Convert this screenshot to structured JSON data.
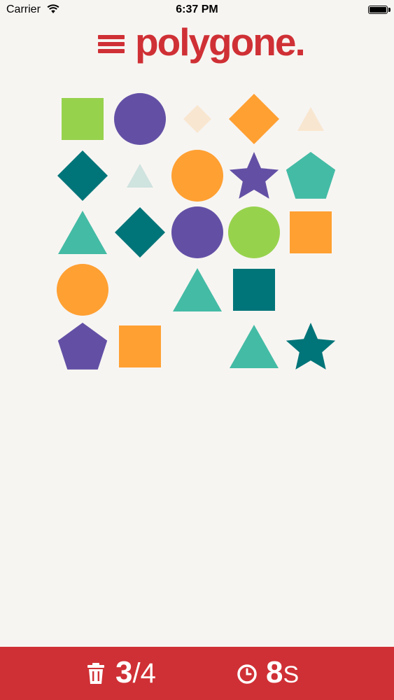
{
  "status_bar": {
    "carrier": "Carrier",
    "time": "6:37 PM"
  },
  "header": {
    "logo": "polygone.",
    "menu_icon": "hamburger-menu-icon"
  },
  "colors": {
    "red": "#cf3035",
    "green": "#97d24d",
    "purple": "#6350a5",
    "orange": "#ffa032",
    "teal": "#007579",
    "turquoise": "#44bba5",
    "pale_peach": "#f8e6d0",
    "pale_mint": "#cfe3df"
  },
  "board": {
    "columns": 5,
    "rows": 5,
    "tiles": [
      {
        "row": 0,
        "col": 0,
        "shape": "square",
        "color": "green"
      },
      {
        "row": 0,
        "col": 1,
        "shape": "circle",
        "color": "purple"
      },
      {
        "row": 0,
        "col": 2,
        "shape": "diamond",
        "color": "pale_peach",
        "size": "small"
      },
      {
        "row": 0,
        "col": 3,
        "shape": "diamond",
        "color": "orange"
      },
      {
        "row": 0,
        "col": 4,
        "shape": "triangle",
        "color": "pale_peach",
        "size": "small"
      },
      {
        "row": 1,
        "col": 0,
        "shape": "diamond",
        "color": "teal"
      },
      {
        "row": 1,
        "col": 1,
        "shape": "triangle",
        "color": "pale_mint",
        "size": "small"
      },
      {
        "row": 1,
        "col": 2,
        "shape": "circle",
        "color": "orange"
      },
      {
        "row": 1,
        "col": 3,
        "shape": "star",
        "color": "purple"
      },
      {
        "row": 1,
        "col": 4,
        "shape": "pentagon",
        "color": "turquoise"
      },
      {
        "row": 2,
        "col": 0,
        "shape": "triangle",
        "color": "turquoise"
      },
      {
        "row": 2,
        "col": 1,
        "shape": "diamond",
        "color": "teal"
      },
      {
        "row": 2,
        "col": 2,
        "shape": "circle",
        "color": "purple"
      },
      {
        "row": 2,
        "col": 3,
        "shape": "circle",
        "color": "green"
      },
      {
        "row": 2,
        "col": 4,
        "shape": "square",
        "color": "orange"
      },
      {
        "row": 3,
        "col": 0,
        "shape": "circle",
        "color": "orange"
      },
      {
        "row": 3,
        "col": 2,
        "shape": "triangle",
        "color": "turquoise"
      },
      {
        "row": 3,
        "col": 3,
        "shape": "square",
        "color": "teal"
      },
      {
        "row": 4,
        "col": 0,
        "shape": "pentagon",
        "color": "purple"
      },
      {
        "row": 4,
        "col": 1,
        "shape": "square",
        "color": "orange"
      },
      {
        "row": 4,
        "col": 3,
        "shape": "triangle",
        "color": "turquoise"
      },
      {
        "row": 4,
        "col": 4,
        "shape": "star",
        "color": "teal"
      }
    ]
  },
  "footer": {
    "moves_used": "3",
    "moves_sep_total": "/4",
    "timer_value": "8",
    "timer_unit": "S",
    "trash_icon": "trash-icon",
    "clock_icon": "clock-icon"
  }
}
